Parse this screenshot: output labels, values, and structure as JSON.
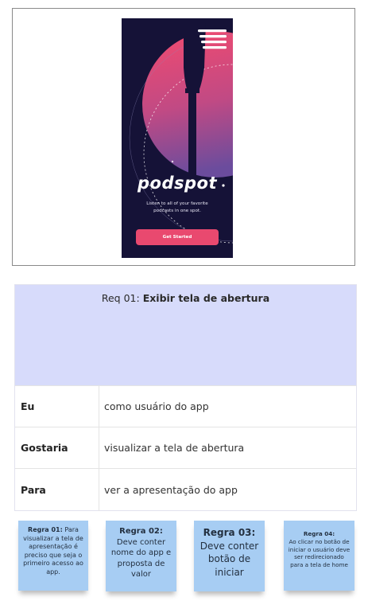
{
  "mockup": {
    "brand": "podspot",
    "tagline": "Listen to all of your favorite podcasts in one spot.",
    "cta_label": "Get Started",
    "colors": {
      "background": "#151237",
      "accent": "#e9496f",
      "gradient_top": "#ee4a72",
      "gradient_bottom": "#7a4ea0"
    }
  },
  "requirement": {
    "prefix": "Req 01: ",
    "title": "Exibir tela de abertura",
    "rows": [
      {
        "key": "Eu",
        "value": "como usuário do app"
      },
      {
        "key": "Gostaria",
        "value": "visualizar a tela de abertura"
      },
      {
        "key": "Para",
        "value": "ver a apresentação do app"
      }
    ],
    "header_color": "#d7dbfb"
  },
  "notes": [
    {
      "title": "Regra 01:",
      "text": "Para visualizar a tela de apresentação é preciso que seja o primeiro acesso ao app."
    },
    {
      "title": "Regra 02:",
      "text": "Deve conter nome do app e proposta de valor"
    },
    {
      "title": "Regra 03:",
      "text": "Deve conter botão de iniciar"
    },
    {
      "title": "Regra 04:",
      "text": "Ao clicar no botão de iniciar o usuário deve ser redirecionado para a tela de home"
    }
  ],
  "note_color": "#a7cdf3"
}
